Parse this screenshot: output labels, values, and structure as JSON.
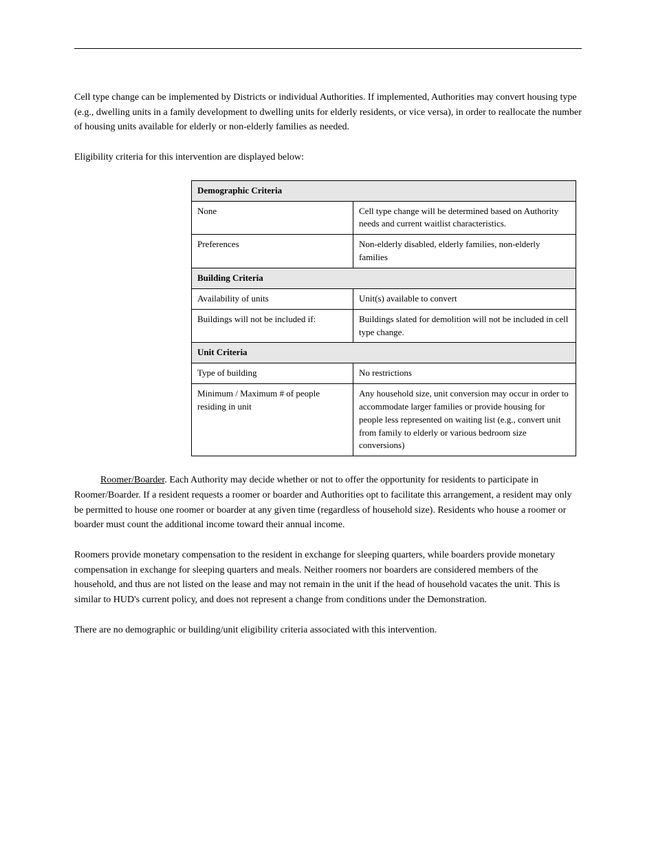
{
  "paragraphs": {
    "cell_type_change": "Cell type change can be implemented by Districts or individual Authorities. If implemented, Authorities may convert housing type (e.g., dwelling units in a family development to dwelling units for elderly residents, or vice versa), in order to reallocate the number of housing units available for elderly or non-elderly families as needed.",
    "criteria_intro": "Eligibility criteria for this intervention are displayed below:"
  },
  "table": {
    "sections": [
      {
        "header": "Demographic Criteria",
        "rows": [
          {
            "col1": "None",
            "col2": "Cell type change will be determined based on Authority needs and current waitlist characteristics."
          },
          {
            "col1": "Preferences",
            "col2": "Non-elderly disabled, elderly families, non-elderly families"
          }
        ]
      },
      {
        "header": "Building Criteria",
        "rows": [
          {
            "col1": "Availability of units",
            "col2": "Unit(s) available to convert"
          },
          {
            "col1": "Buildings will not be included if:",
            "col2": "Buildings slated for demolition will not be included in cell type change."
          }
        ]
      },
      {
        "header": "Unit Criteria",
        "rows": [
          {
            "col1": "Type of building",
            "col2": "No restrictions"
          },
          {
            "col1": "Minimum / Maximum # of people residing in unit",
            "col2": "Any household size, unit conversion may occur in order to accommodate larger families or provide housing for people less represented on waiting list (e.g., convert unit from family to elderly or various bedroom size conversions)"
          }
        ]
      }
    ]
  },
  "after": {
    "p1_label": "Roomer/Boarder",
    "p1_body": ". Each Authority may decide whether or not to offer the opportunity for residents to participate in Roomer/Boarder. If a resident requests a roomer or boarder and Authorities opt to facilitate this arrangement, a resident may only be permitted to house one roomer or boarder at any given time (regardless of household size). Residents who house a roomer or boarder must count the additional income toward their annual income.",
    "p2": "Roomers provide monetary compensation to the resident in exchange for sleeping quarters, while boarders provide monetary compensation in exchange for sleeping quarters and meals. Neither roomers nor boarders are considered members of the household, and thus are not listed on the lease and may not remain in the unit if the head of household vacates the unit. This is similar to HUD's current policy, and does not represent a change from conditions under the Demonstration.",
    "p3": "There are no demographic or building/unit eligibility criteria associated with this intervention."
  }
}
